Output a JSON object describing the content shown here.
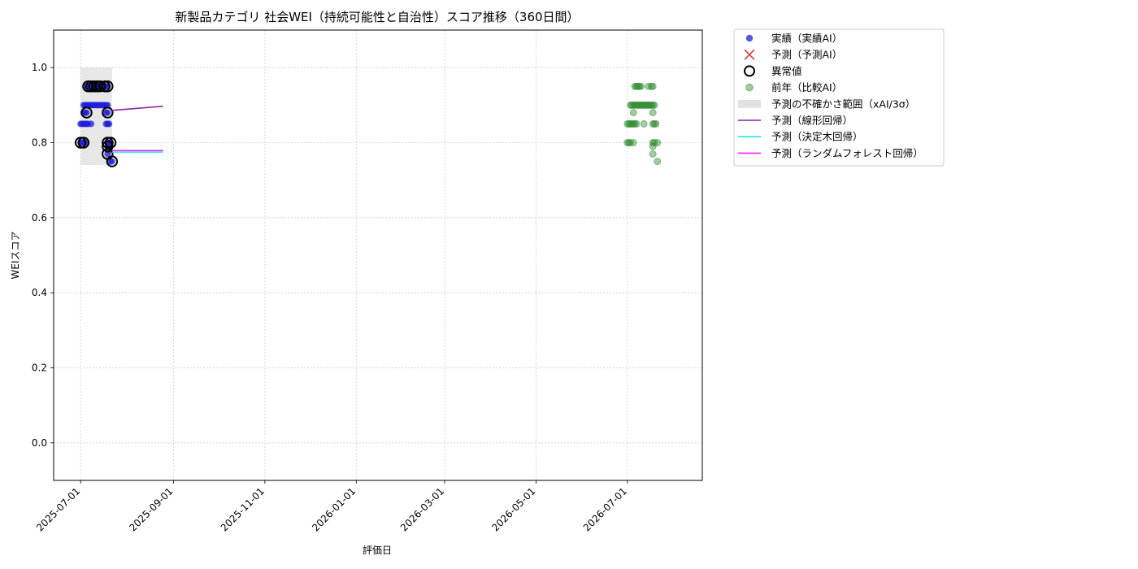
{
  "chart_data": {
    "type": "scatter",
    "title": "新製品カテゴリ 社会WEI（持続可能性と自治性）スコア推移（360日間）",
    "xlabel": "評価日",
    "ylabel": "WEIスコア",
    "xlim": [
      "2025-06-13",
      "2026-08-20"
    ],
    "ylim": [
      -0.1,
      1.1
    ],
    "x_ticks": [
      "2025-07-01",
      "2025-09-01",
      "2025-11-01",
      "2026-01-01",
      "2026-03-01",
      "2026-05-01",
      "2026-07-01"
    ],
    "y_ticks": [
      0.0,
      0.2,
      0.4,
      0.6,
      0.8,
      1.0
    ],
    "grid": true,
    "legend_position": "outside-top-right",
    "colors": {
      "actual": "#1f1fd9",
      "predicted": "#e53935",
      "anomaly_edge": "#000000",
      "previous_year": "#2e8b2e",
      "uncertainty": "#d3d3d3",
      "linear": "#8e24aa",
      "tree": "#22e5e5",
      "forest": "#ff22ff"
    },
    "legend": [
      {
        "key": "actual",
        "label": "実績（実績AI）",
        "marker": "dot"
      },
      {
        "key": "predicted",
        "label": "予測（予測AI）",
        "marker": "x"
      },
      {
        "key": "anomaly",
        "label": "異常値",
        "marker": "ring"
      },
      {
        "key": "previous_year",
        "label": "前年（比較AI）",
        "marker": "dot-faint"
      },
      {
        "key": "uncertainty",
        "label": "予測の不確かさ範囲（xAI/3σ）",
        "marker": "band"
      },
      {
        "key": "linear",
        "label": "予測（線形回帰）",
        "marker": "line"
      },
      {
        "key": "tree",
        "label": "予測（決定木回帰）",
        "marker": "line"
      },
      {
        "key": "forest",
        "label": "予測（ランダムフォレスト回帰）",
        "marker": "line"
      }
    ],
    "uncertainty_band": {
      "x": [
        "2025-07-01",
        "2025-07-22"
      ],
      "y": [
        0.74,
        1.0
      ]
    },
    "series": [
      {
        "key": "actual",
        "points": [
          {
            "x": "2025-07-01",
            "y": 0.8
          },
          {
            "x": "2025-07-02",
            "y": 0.8
          },
          {
            "x": "2025-07-03",
            "y": 0.8
          },
          {
            "x": "2025-07-04",
            "y": 0.8
          },
          {
            "x": "2025-07-01",
            "y": 0.85
          },
          {
            "x": "2025-07-02",
            "y": 0.85
          },
          {
            "x": "2025-07-03",
            "y": 0.85
          },
          {
            "x": "2025-07-04",
            "y": 0.85
          },
          {
            "x": "2025-07-05",
            "y": 0.85
          },
          {
            "x": "2025-07-06",
            "y": 0.85
          },
          {
            "x": "2025-07-08",
            "y": 0.85
          },
          {
            "x": "2025-07-03",
            "y": 0.88
          },
          {
            "x": "2025-07-04",
            "y": 0.88
          },
          {
            "x": "2025-07-05",
            "y": 0.88
          },
          {
            "x": "2025-07-03",
            "y": 0.9
          },
          {
            "x": "2025-07-04",
            "y": 0.9
          },
          {
            "x": "2025-07-05",
            "y": 0.9
          },
          {
            "x": "2025-07-06",
            "y": 0.9
          },
          {
            "x": "2025-07-07",
            "y": 0.9
          },
          {
            "x": "2025-07-08",
            "y": 0.9
          },
          {
            "x": "2025-07-09",
            "y": 0.9
          },
          {
            "x": "2025-07-10",
            "y": 0.9
          },
          {
            "x": "2025-07-11",
            "y": 0.9
          },
          {
            "x": "2025-07-12",
            "y": 0.9
          },
          {
            "x": "2025-07-13",
            "y": 0.9
          },
          {
            "x": "2025-07-14",
            "y": 0.9
          },
          {
            "x": "2025-07-15",
            "y": 0.9
          },
          {
            "x": "2025-07-16",
            "y": 0.9
          },
          {
            "x": "2025-07-17",
            "y": 0.9
          },
          {
            "x": "2025-07-18",
            "y": 0.9
          },
          {
            "x": "2025-07-19",
            "y": 0.9
          },
          {
            "x": "2025-07-05",
            "y": 0.95
          },
          {
            "x": "2025-07-06",
            "y": 0.95
          },
          {
            "x": "2025-07-07",
            "y": 0.95
          },
          {
            "x": "2025-07-08",
            "y": 0.95
          },
          {
            "x": "2025-07-09",
            "y": 0.95
          },
          {
            "x": "2025-07-10",
            "y": 0.95
          },
          {
            "x": "2025-07-11",
            "y": 0.95
          },
          {
            "x": "2025-07-12",
            "y": 0.95
          },
          {
            "x": "2025-07-13",
            "y": 0.95
          },
          {
            "x": "2025-07-14",
            "y": 0.95
          },
          {
            "x": "2025-07-15",
            "y": 0.95
          },
          {
            "x": "2025-07-16",
            "y": 0.95
          },
          {
            "x": "2025-07-17",
            "y": 0.95
          },
          {
            "x": "2025-07-18",
            "y": 0.95
          },
          {
            "x": "2025-07-19",
            "y": 0.95
          },
          {
            "x": "2025-07-18",
            "y": 0.88
          },
          {
            "x": "2025-07-19",
            "y": 0.88
          },
          {
            "x": "2025-07-18",
            "y": 0.85
          },
          {
            "x": "2025-07-19",
            "y": 0.85
          },
          {
            "x": "2025-07-20",
            "y": 0.85
          },
          {
            "x": "2025-07-19",
            "y": 0.8
          },
          {
            "x": "2025-07-20",
            "y": 0.8
          },
          {
            "x": "2025-07-21",
            "y": 0.8
          },
          {
            "x": "2025-07-19",
            "y": 0.79
          },
          {
            "x": "2025-07-20",
            "y": 0.78
          },
          {
            "x": "2025-07-19",
            "y": 0.77
          },
          {
            "x": "2025-07-21",
            "y": 0.75
          },
          {
            "x": "2025-07-22",
            "y": 0.75
          }
        ]
      },
      {
        "key": "anomaly",
        "points": [
          {
            "x": "2025-07-01",
            "y": 0.8
          },
          {
            "x": "2025-07-03",
            "y": 0.8
          },
          {
            "x": "2025-07-05",
            "y": 0.88
          },
          {
            "x": "2025-07-06",
            "y": 0.95
          },
          {
            "x": "2025-07-08",
            "y": 0.95
          },
          {
            "x": "2025-07-10",
            "y": 0.95
          },
          {
            "x": "2025-07-12",
            "y": 0.95
          },
          {
            "x": "2025-07-14",
            "y": 0.95
          },
          {
            "x": "2025-07-17",
            "y": 0.95
          },
          {
            "x": "2025-07-19",
            "y": 0.95
          },
          {
            "x": "2025-07-19",
            "y": 0.88
          },
          {
            "x": "2025-07-19",
            "y": 0.8
          },
          {
            "x": "2025-07-21",
            "y": 0.8
          },
          {
            "x": "2025-07-19",
            "y": 0.79
          },
          {
            "x": "2025-07-19",
            "y": 0.77
          },
          {
            "x": "2025-07-22",
            "y": 0.75
          }
        ]
      },
      {
        "key": "previous_year",
        "points": [
          {
            "x": "2026-07-01",
            "y": 0.8
          },
          {
            "x": "2026-07-02",
            "y": 0.8
          },
          {
            "x": "2026-07-03",
            "y": 0.8
          },
          {
            "x": "2026-07-05",
            "y": 0.8
          },
          {
            "x": "2026-07-01",
            "y": 0.85
          },
          {
            "x": "2026-07-02",
            "y": 0.85
          },
          {
            "x": "2026-07-03",
            "y": 0.85
          },
          {
            "x": "2026-07-04",
            "y": 0.85
          },
          {
            "x": "2026-07-05",
            "y": 0.85
          },
          {
            "x": "2026-07-06",
            "y": 0.85
          },
          {
            "x": "2026-07-07",
            "y": 0.85
          },
          {
            "x": "2026-07-05",
            "y": 0.88
          },
          {
            "x": "2026-07-03",
            "y": 0.9
          },
          {
            "x": "2026-07-04",
            "y": 0.9
          },
          {
            "x": "2026-07-05",
            "y": 0.9
          },
          {
            "x": "2026-07-06",
            "y": 0.9
          },
          {
            "x": "2026-07-07",
            "y": 0.9
          },
          {
            "x": "2026-07-08",
            "y": 0.9
          },
          {
            "x": "2026-07-09",
            "y": 0.9
          },
          {
            "x": "2026-07-10",
            "y": 0.9
          },
          {
            "x": "2026-07-11",
            "y": 0.9
          },
          {
            "x": "2026-07-12",
            "y": 0.9
          },
          {
            "x": "2026-07-13",
            "y": 0.9
          },
          {
            "x": "2026-07-14",
            "y": 0.9
          },
          {
            "x": "2026-07-15",
            "y": 0.9
          },
          {
            "x": "2026-07-16",
            "y": 0.9
          },
          {
            "x": "2026-07-17",
            "y": 0.9
          },
          {
            "x": "2026-07-18",
            "y": 0.9
          },
          {
            "x": "2026-07-19",
            "y": 0.9
          },
          {
            "x": "2026-07-06",
            "y": 0.95
          },
          {
            "x": "2026-07-07",
            "y": 0.95
          },
          {
            "x": "2026-07-08",
            "y": 0.95
          },
          {
            "x": "2026-07-09",
            "y": 0.95
          },
          {
            "x": "2026-07-10",
            "y": 0.95
          },
          {
            "x": "2026-07-15",
            "y": 0.95
          },
          {
            "x": "2026-07-17",
            "y": 0.95
          },
          {
            "x": "2026-07-18",
            "y": 0.95
          },
          {
            "x": "2026-07-12",
            "y": 0.85
          },
          {
            "x": "2026-07-18",
            "y": 0.85
          },
          {
            "x": "2026-07-19",
            "y": 0.85
          },
          {
            "x": "2026-07-20",
            "y": 0.85
          },
          {
            "x": "2026-07-18",
            "y": 0.88
          },
          {
            "x": "2026-07-18",
            "y": 0.8
          },
          {
            "x": "2026-07-19",
            "y": 0.8
          },
          {
            "x": "2026-07-21",
            "y": 0.8
          },
          {
            "x": "2026-07-18",
            "y": 0.79
          },
          {
            "x": "2026-07-18",
            "y": 0.77
          },
          {
            "x": "2026-07-21",
            "y": 0.75
          }
        ]
      }
    ],
    "lines": [
      {
        "key": "linear",
        "points": [
          {
            "x": "2025-07-22",
            "y": 0.886
          },
          {
            "x": "2025-08-25",
            "y": 0.897
          }
        ]
      },
      {
        "key": "tree",
        "points": [
          {
            "x": "2025-07-22",
            "y": 0.775
          },
          {
            "x": "2025-08-25",
            "y": 0.775
          }
        ]
      },
      {
        "key": "forest",
        "points": [
          {
            "x": "2025-07-22",
            "y": 0.779
          },
          {
            "x": "2025-08-25",
            "y": 0.779
          }
        ]
      }
    ]
  }
}
